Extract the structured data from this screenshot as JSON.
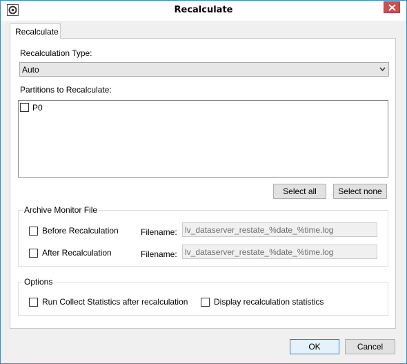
{
  "window": {
    "title": "Recalculate",
    "app_icon": "gear-icon",
    "close_icon": "close-icon",
    "accent_color": "#2f8fc4",
    "close_color": "#c75050"
  },
  "tab": {
    "label": "Recalculate"
  },
  "recalc_type": {
    "label": "Recalculation Type:",
    "selected": "Auto"
  },
  "partitions": {
    "label": "Partitions to Recalculate:",
    "items": [
      {
        "label": "P0",
        "checked": false
      }
    ],
    "select_all_label": "Select all",
    "select_none_label": "Select none"
  },
  "archive": {
    "title": "Archive Monitor File",
    "before": {
      "label": "Before Recalculation",
      "checked": false,
      "filename_label": "Filename:",
      "filename_value": "lv_dataserver_restate_%date_%time.log"
    },
    "after": {
      "label": "After Recalculation",
      "checked": false,
      "filename_label": "Filename:",
      "filename_value": "lv_dataserver_restate_%date_%time.log"
    }
  },
  "options": {
    "title": "Options",
    "collect_stats": {
      "label": "Run Collect Statistics after recalculation",
      "checked": false
    },
    "display_stats": {
      "label": "Display recalculation statistics",
      "checked": false
    }
  },
  "footer": {
    "ok_label": "OK",
    "cancel_label": "Cancel"
  }
}
